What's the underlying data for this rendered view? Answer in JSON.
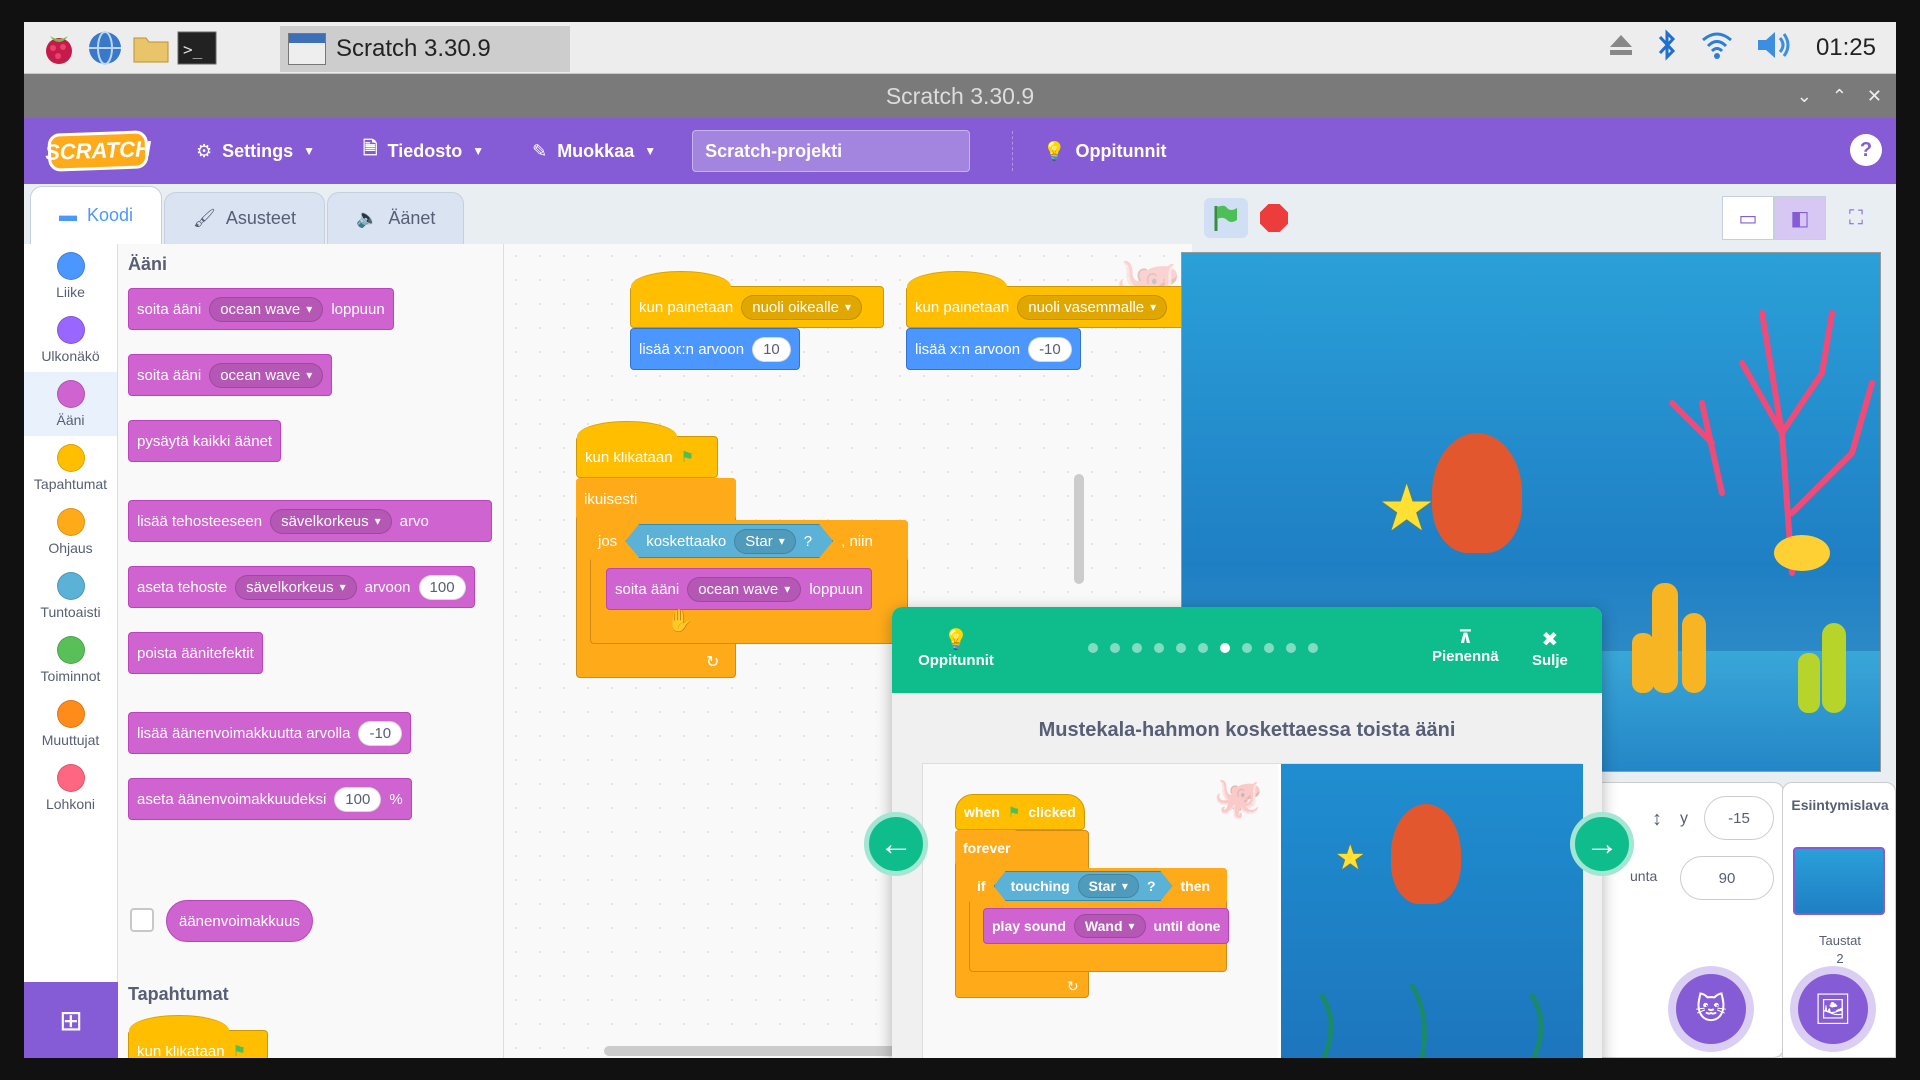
{
  "taskbar": {
    "window_title": "Scratch 3.30.9",
    "clock": "01:25",
    "icons": [
      "raspberry-icon",
      "globe-icon",
      "folder-icon",
      "terminal-icon",
      "eject-icon",
      "bluetooth-icon",
      "wifi-icon",
      "volume-icon"
    ]
  },
  "titlebar": {
    "title": "Scratch 3.30.9"
  },
  "menubar": {
    "logo": "SCRATCH",
    "settings": "Settings",
    "file": "Tiedosto",
    "edit": "Muokkaa",
    "project_title": "Scratch-projekti",
    "tutorials": "Oppitunnit",
    "help": "?"
  },
  "tabs": {
    "code": "Koodi",
    "costumes": "Asusteet",
    "sounds": "Äänet"
  },
  "categories": [
    {
      "label": "Liike",
      "color": "#4c97ff"
    },
    {
      "label": "Ulkonäkö",
      "color": "#9966ff"
    },
    {
      "label": "Ääni",
      "color": "#cf63cf"
    },
    {
      "label": "Tapahtumat",
      "color": "#ffbf00"
    },
    {
      "label": "Ohjaus",
      "color": "#ffab19"
    },
    {
      "label": "Tuntoaisti",
      "color": "#5cb1d6"
    },
    {
      "label": "Toiminnot",
      "color": "#59c059"
    },
    {
      "label": "Muuttujat",
      "color": "#ff8c1a"
    },
    {
      "label": "Lohkoni",
      "color": "#ff6680"
    }
  ],
  "flyout": {
    "sound_header": "Ääni",
    "play_until_done": {
      "a": "soita ääni",
      "dd": "ocean wave",
      "b": "loppuun"
    },
    "start_sound": {
      "a": "soita ääni",
      "dd": "ocean wave"
    },
    "stop_all": "pysäytä kaikki äänet",
    "change_effect": {
      "a": "lisää tehosteeseen",
      "dd": "sävelkorkeus",
      "b": "arvo"
    },
    "set_effect": {
      "a": "aseta tehoste",
      "dd": "sävelkorkeus",
      "b": "arvoon",
      "n": "100"
    },
    "clear_effects": "poista äänitefektit",
    "change_volume": {
      "a": "lisää äänenvoimakkuutta arvolla",
      "n": "-10"
    },
    "set_volume": {
      "a": "aseta äänenvoimakkuudeksi",
      "n": "100",
      "b": "%"
    },
    "volume_reporter": "äänenvoimakkuus",
    "events_header": "Tapahtumat",
    "when_flag": "kun klikataan"
  },
  "workspace": {
    "script1": {
      "hat": "kun painetaan",
      "key": "nuoli oikealle",
      "move": "lisää x:n arvoon",
      "n": "10"
    },
    "script2": {
      "hat": "kun painetaan",
      "key": "nuoli vasemmalle",
      "move": "lisää x:n arvoon",
      "n": "-10"
    },
    "script3": {
      "hat": "kun klikataan",
      "forever": "ikuisesti",
      "if": "jos",
      "touching": "koskettaako",
      "target": "Star",
      "q": "?",
      "then": ", niin",
      "play": "soita ääni",
      "sound": "ocean wave",
      "until": "loppuun"
    }
  },
  "sprite_info": {
    "y_label": "y",
    "y_value": "-15",
    "dir_label": "unta",
    "dir_value": "90"
  },
  "stage_pane": {
    "title": "Esiintymislava",
    "backdrops_label": "Taustat",
    "backdrops_count": "2"
  },
  "tutorial": {
    "header_label": "Oppitunnit",
    "shrink": "Pienennä",
    "close": "Sulje",
    "step_count": 11,
    "current_step": 7,
    "title": "Mustekala-hahmon koskettaessa toista ääni",
    "code": {
      "hat": "when",
      "hat2": "clicked",
      "forever": "forever",
      "if": "if",
      "touching": "touching",
      "target": "Star",
      "q": "?",
      "then": "then",
      "play": "play sound",
      "sound": "Wand",
      "until": "until done"
    }
  }
}
